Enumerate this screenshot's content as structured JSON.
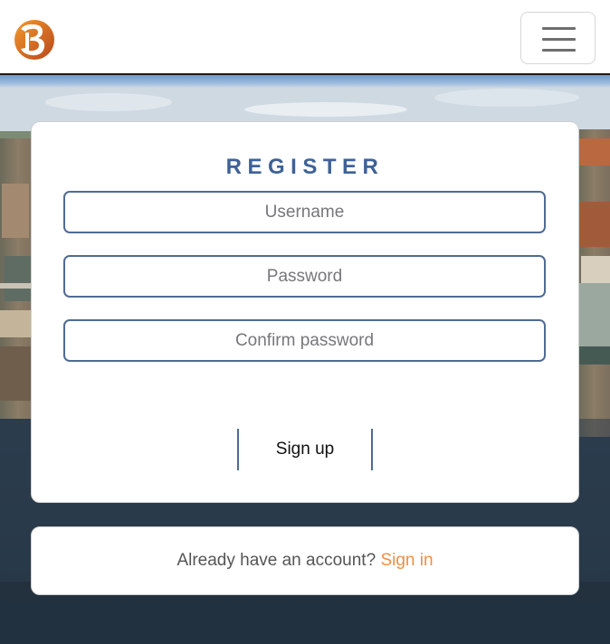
{
  "navbar": {
    "logo_alt": "B",
    "menu_icon": "hamburger-menu-icon"
  },
  "register": {
    "title": "REGISTER",
    "username_placeholder": "Username",
    "password_placeholder": "Password",
    "confirm_placeholder": "Confirm password",
    "signup_label": "Sign up"
  },
  "signin": {
    "prompt": "Already have an account?",
    "link_label": "Sign in"
  },
  "colors": {
    "accent_blue": "#3e6296",
    "field_border": "#4f6b93",
    "link_orange": "#ef8f44"
  }
}
